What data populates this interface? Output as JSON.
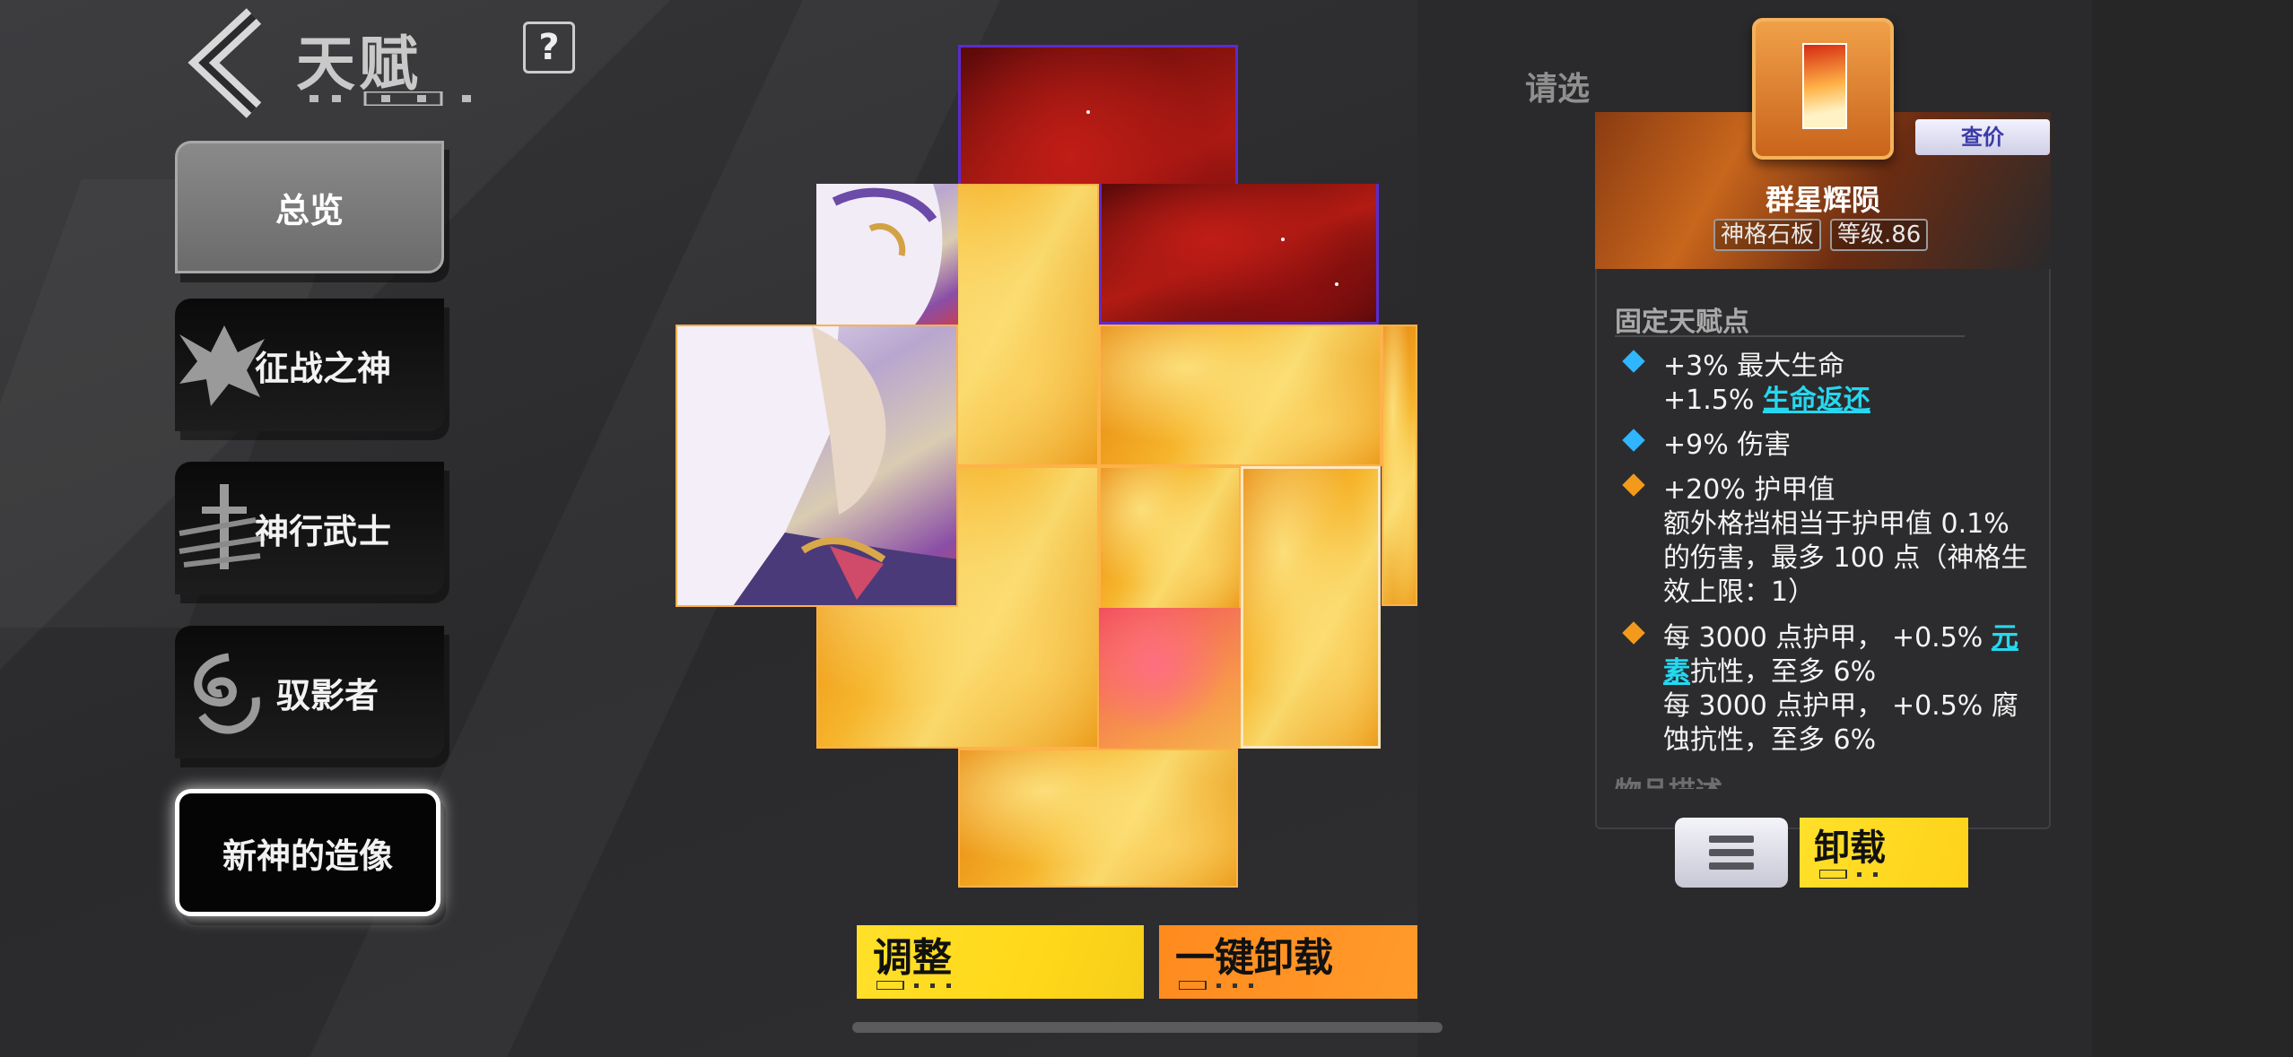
{
  "header": {
    "title": "天赋",
    "help_label": "?"
  },
  "sidebar": {
    "items": [
      {
        "label": "总览",
        "state": "selected"
      },
      {
        "label": "征战之神",
        "icon": "winged-demon-icon"
      },
      {
        "label": "神行武士",
        "icon": "sword-icon"
      },
      {
        "label": "驭影者",
        "icon": "shadow-swirl-icon"
      },
      {
        "label": "新神的造像",
        "state": "active"
      }
    ]
  },
  "board": {
    "tiles": [
      "space",
      "portrait",
      "fire",
      "fire",
      "fire",
      "fire",
      "pink",
      "fire",
      "fire"
    ]
  },
  "actions": {
    "adjust_label": "调整",
    "unload_all_label": "一键卸载"
  },
  "detail": {
    "hint": "请选",
    "price_label": "查价",
    "item_name": "群星辉陨",
    "item_type": "神格石板",
    "item_level": "等级.86",
    "section_title": "固定天赋点",
    "stats": [
      {
        "bullet": "blue",
        "lines": [
          "+3% 最大生命"
        ]
      },
      {
        "bullet": "none",
        "lines_pre": "+1.5% ",
        "link": "生命返还"
      },
      {
        "bullet": "blue",
        "lines": [
          "+9% 伤害"
        ]
      },
      {
        "bullet": "orange",
        "lines": [
          "+20% 护甲值",
          "额外格挡相当于护甲值 0.1%",
          "的伤害，最多 100 点（神格生",
          "效上限：1）"
        ]
      },
      {
        "bullet": "orange",
        "line1_pre": "每 3000 点护甲，  +0.5% ",
        "line1_link": "元",
        "line2_link": "素",
        "line2_post": "抗性，至多 6%",
        "line3": "每 3000 点护甲，  +0.5% 腐",
        "line4": "蚀抗性，至多 6%"
      }
    ],
    "desc_title": "物品描述",
    "unload_label": "卸载"
  },
  "colors": {
    "accent_yellow": "#ffd81a",
    "accent_orange": "#ff8a1e",
    "link_cyan": "#25d8f0",
    "bullet_blue": "#2fb6ff",
    "bullet_orange": "#f39a1c"
  }
}
